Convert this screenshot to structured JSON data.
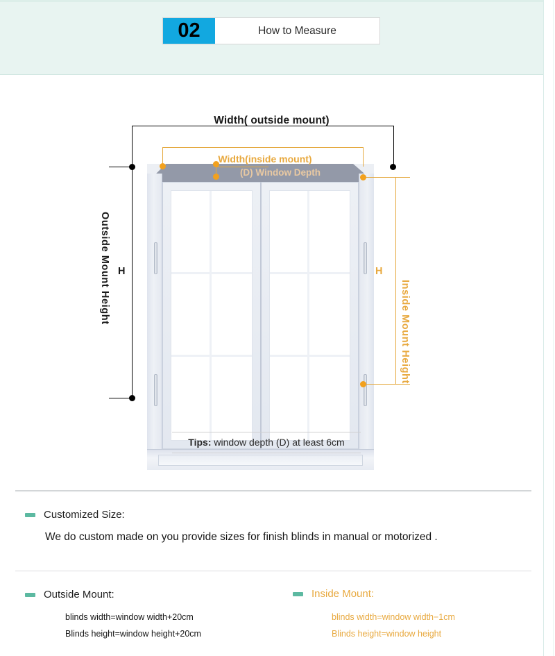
{
  "header": {
    "badge_number": "02",
    "title": "How to Measure",
    "badge_color": "#12a8e0",
    "background_color": "#e8f4f1"
  },
  "diagram": {
    "labels": {
      "width_outside": "Width( outside mount)",
      "width_inside": "Width(inside mount)",
      "window_depth": "(D) Window Depth",
      "outside_mount_height": "Outside Mount  Height",
      "inside_mount_height": "Inside Mount  Height",
      "h_left": "H",
      "h_right": "H"
    },
    "colors": {
      "outside_annotation": "#000000",
      "inside_annotation": "#e8a93f",
      "depth_annotation": "#e9c9a2"
    },
    "tips": {
      "prefix": "Tips:",
      "text": " window depth (D) at least 6cm"
    }
  },
  "info": {
    "customized": {
      "heading": "Customized Size:",
      "body": "We do custom made on you provide sizes for finish blinds in manual or motorized ."
    },
    "outside_mount": {
      "heading": "Outside Mount:",
      "line1": "blinds width=window width+20cm",
      "line2": "Blinds height=window height+20cm"
    },
    "inside_mount": {
      "heading": "Inside Mount:",
      "line1": "blinds width=window width−1cm",
      "line2": "Blinds height=window height"
    },
    "bullet_color": "#5cb9a1"
  }
}
